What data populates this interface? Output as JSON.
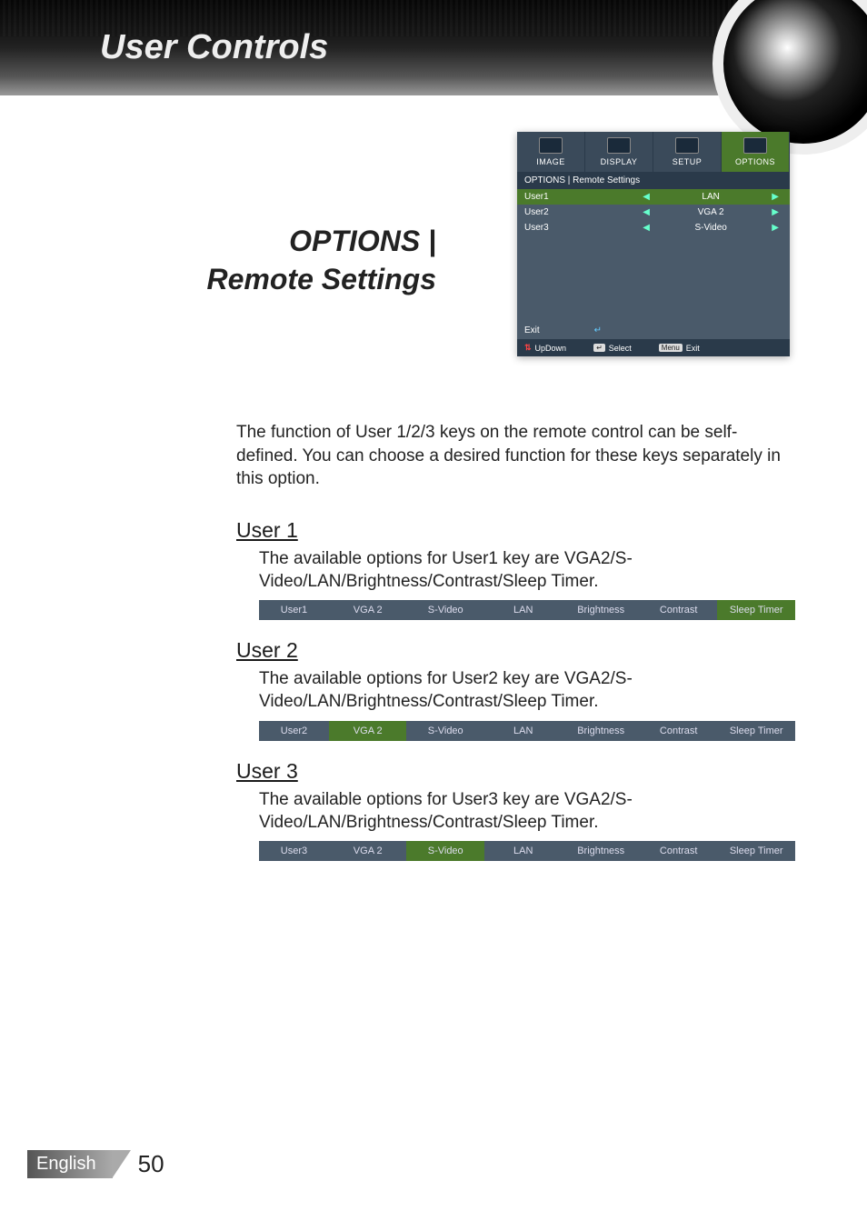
{
  "header": {
    "title": "User Controls"
  },
  "section": {
    "heading_line1": "OPTIONS |",
    "heading_line2": "Remote Settings"
  },
  "osd": {
    "tabs": [
      "IMAGE",
      "DISPLAY",
      "SETUP",
      "OPTIONS"
    ],
    "breadcrumb": "OPTIONS | Remote Settings",
    "rows": [
      {
        "label": "User1",
        "value": "LAN"
      },
      {
        "label": "User2",
        "value": "VGA 2"
      },
      {
        "label": "User3",
        "value": "S-Video"
      }
    ],
    "exit": "Exit",
    "footer": {
      "updown": "UpDown",
      "select": "Select",
      "menu": "Menu",
      "exit": "Exit"
    }
  },
  "intro": "The function of User 1/2/3 keys on the remote control can be self-defined. You can choose a desired function for these keys separately in this option.",
  "users": [
    {
      "title": "User 1",
      "desc": "The available options for User1 key are VGA2/S-Video/LAN/Brightness/Contrast/Sleep Timer.",
      "bar_label": "User1",
      "options": [
        "VGA 2",
        "S-Video",
        "LAN",
        "Brightness",
        "Contrast",
        "Sleep Timer"
      ],
      "selected_index": 5
    },
    {
      "title": "User 2",
      "desc": "The available options for User2 key are VGA2/S-Video/LAN/Brightness/Contrast/Sleep Timer.",
      "bar_label": "User2",
      "options": [
        "VGA 2",
        "S-Video",
        "LAN",
        "Brightness",
        "Contrast",
        "Sleep Timer"
      ],
      "selected_index": 0
    },
    {
      "title": "User 3",
      "desc": "The available options for User3 key are VGA2/S-Video/LAN/Brightness/Contrast/Sleep Timer.",
      "bar_label": "User3",
      "options": [
        "VGA 2",
        "S-Video",
        "LAN",
        "Brightness",
        "Contrast",
        "Sleep Timer"
      ],
      "selected_index": 1
    }
  ],
  "footer": {
    "language": "English",
    "page": "50"
  }
}
